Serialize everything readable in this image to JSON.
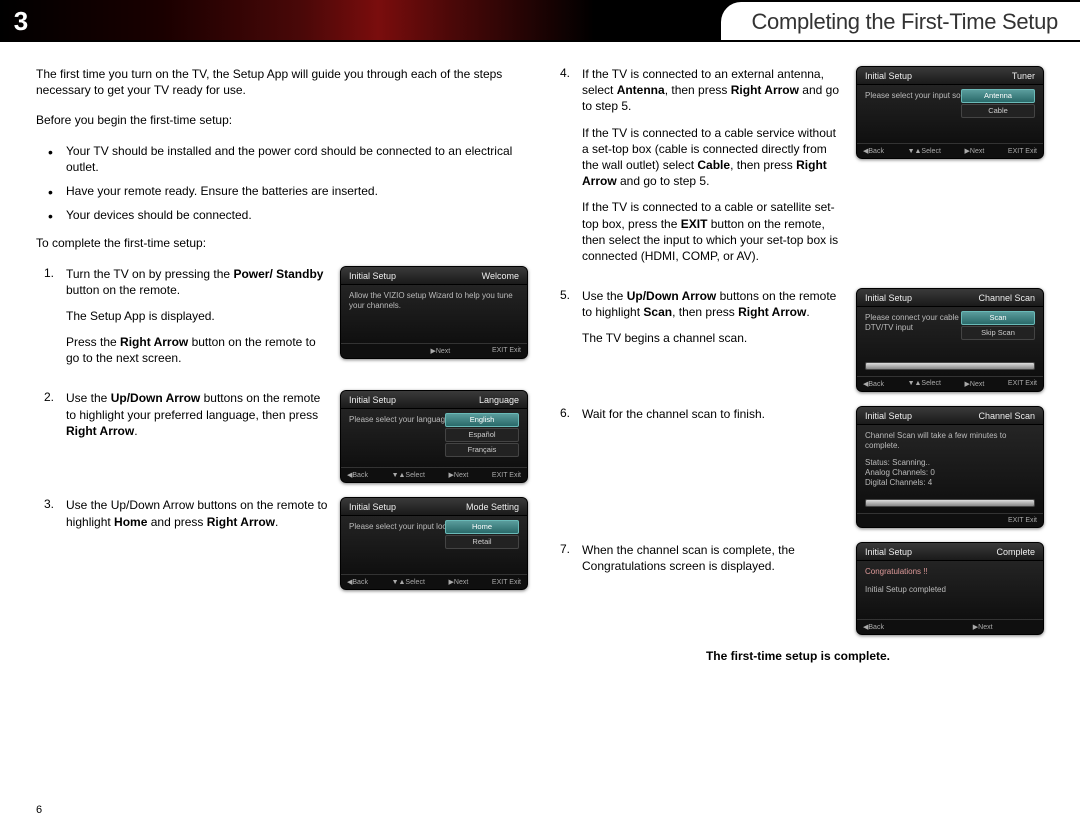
{
  "header": {
    "chapter": "3",
    "title": "Completing the First-Time Setup"
  },
  "intro": "The first time you turn on the TV, the Setup App will guide you through each of the steps necessary to get your TV ready for use.",
  "before_label": "Before you begin the first-time setup:",
  "bullets": [
    "Your TV should be installed and the power cord should be connected to an electrical outlet.",
    "Have your remote ready. Ensure the batteries are inserted.",
    "Your devices should be connected."
  ],
  "complete_label": "To complete the first-time setup:",
  "steps": {
    "s1": {
      "n": "1.",
      "l1a": "Turn the TV on by pressing the ",
      "l1b": "Power/ Standby",
      "l1c": " button on the remote.",
      "l2": "The Setup App is displayed.",
      "l3a": "Press the ",
      "l3b": "Right Arrow",
      "l3c": " button on the remote to go to the next screen."
    },
    "s2": {
      "n": "2.",
      "a": "Use the ",
      "b": "Up/Down Arrow",
      "c": " buttons on the remote to highlight your preferred language, then press ",
      "d": "Right Arrow",
      "e": "."
    },
    "s3": {
      "n": "3.",
      "a": "Use the Up/Down Arrow buttons on the remote to highlight ",
      "b": "Home",
      "c": " and press ",
      "d": "Right Arrow",
      "e": "."
    },
    "s4": {
      "n": "4.",
      "p1a": "If the TV is connected to an external antenna, select ",
      "p1b": "Antenna",
      "p1c": ", then press ",
      "p1d": "Right Arrow",
      "p1e": " and go to step 5.",
      "p2a": "If the TV is connected to a cable service without a set-top box (cable is connected directly from the wall outlet) select ",
      "p2b": "Cable",
      "p2c": ", then press ",
      "p2d": "Right Arrow",
      "p2e": " and go to step 5.",
      "p3a": "If the TV is connected to a cable or satellite set-top box, press the ",
      "p3b": "EXIT",
      "p3c": " button on the remote, then select the input to which your set-top box is connected (HDMI, COMP, or AV)."
    },
    "s5": {
      "n": "5.",
      "a": "Use the ",
      "b": "Up/Down Arrow",
      "c": " buttons on the remote to highlight ",
      "d": "Scan",
      "e": ", then press ",
      "f": "Right Arrow",
      "g": ".",
      "l2": "The TV begins a channel scan."
    },
    "s6": {
      "n": "6.",
      "a": "Wait for the channel scan to finish."
    },
    "s7": {
      "n": "7.",
      "a": "When the channel scan is complete, the Congratulations screen is displayed."
    }
  },
  "final": "The first-time setup is complete.",
  "pagenum": "6",
  "thumbs": {
    "t1": {
      "title": "Initial Setup",
      "sub": "Welcome",
      "body": "Allow the VIZIO setup Wizard to help you tune your channels."
    },
    "t2": {
      "title": "Initial Setup",
      "sub": "Language",
      "prompt": "Please select your language:",
      "opts": [
        "English",
        "Español",
        "Français"
      ]
    },
    "t3": {
      "title": "Initial Setup",
      "sub": "Mode Setting",
      "prompt": "Please select your input location:",
      "opts": [
        "Home",
        "Retail"
      ]
    },
    "t4": {
      "title": "Initial Setup",
      "sub": "Tuner",
      "prompt": "Please select your input source:",
      "opts": [
        "Antenna",
        "Cable"
      ]
    },
    "t5": {
      "title": "Initial Setup",
      "sub": "Channel Scan",
      "prompt": "Please connect your cable or antenna to the DTV/TV input",
      "opts": [
        "Scan",
        "Skip Scan"
      ]
    },
    "t6": {
      "title": "Initial Setup",
      "sub": "Channel Scan",
      "l1": "Channel Scan will take a few minutes to complete.",
      "l2": "Status: Scanning..",
      "l3": "Analog Channels: 0",
      "l4": "Digital Channels: 4"
    },
    "t7": {
      "title": "Initial Setup",
      "sub": "Complete",
      "l1": "Congratulations !!",
      "l2": "Initial Setup completed"
    },
    "ft": {
      "back": "◀Back",
      "select": "▼▲Select",
      "next": "▶Next",
      "exit": "EXIT Exit"
    }
  }
}
